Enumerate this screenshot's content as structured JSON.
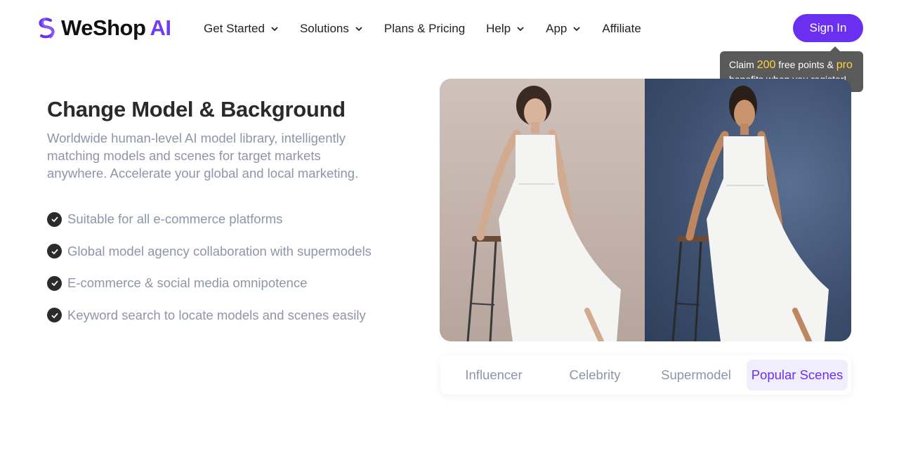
{
  "header": {
    "logo": {
      "name": "WeShop",
      "suffix": "AI"
    },
    "nav": [
      {
        "label": "Get Started",
        "has_dropdown": true
      },
      {
        "label": "Solutions",
        "has_dropdown": true
      },
      {
        "label": "Plans & Pricing",
        "has_dropdown": false
      },
      {
        "label": "Help",
        "has_dropdown": true
      },
      {
        "label": "App",
        "has_dropdown": true
      },
      {
        "label": "Affiliate",
        "has_dropdown": false
      }
    ],
    "sign_in_label": "Sign In"
  },
  "tooltip": {
    "part1": "Claim ",
    "points": "200",
    "part2": " free points & ",
    "pro": "pro",
    "part3": "benefits when you register!"
  },
  "hero": {
    "title": "Change Model & Background",
    "description": "Worldwide human-level AI model library, intelligently matching models and scenes for target markets anywhere. Accelerate your global and local marketing.",
    "features": [
      "Suitable for all e-commerce platforms",
      "Global model agency collaboration with supermodels",
      "E-commerce & social media omnipotence",
      "Keyword search to locate models and scenes easily"
    ]
  },
  "tabs": {
    "items": [
      "Influencer",
      "Celebrity",
      "Supermodel",
      "Popular Scenes"
    ],
    "active": "Popular Scenes"
  },
  "colors": {
    "brand": "#6b2ff0",
    "muted_text": "#8f95a8",
    "tooltip_bg": "#5a5a5a",
    "highlight": "#ffd23c"
  }
}
